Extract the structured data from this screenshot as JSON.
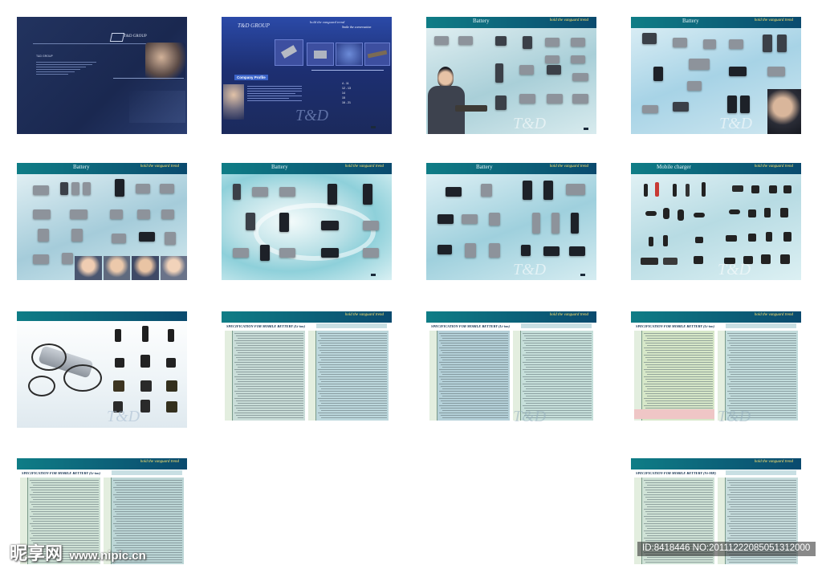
{
  "brand": {
    "name": "T&D GROUP",
    "slogan": "hold the vanguard trend",
    "slogan2": "Smile the conversation"
  },
  "pages": {
    "cover": {
      "group": "T&D GROUP"
    },
    "profile": {
      "group": "T&D GROUP",
      "section": "Company Profile",
      "toc": [
        "4 - 11",
        "12 - 13",
        "14",
        "15",
        "16 - 21"
      ]
    },
    "battery1": {
      "title": "Battery"
    },
    "battery2": {
      "title": "Battery"
    },
    "battery3": {
      "title": "Battery"
    },
    "battery4": {
      "title": "Battery"
    },
    "battery5": {
      "title": "Battery"
    },
    "charger": {
      "title": "Mobile charger"
    },
    "spec1": {
      "title": "SPECIFICATION FOR MOBILE BETTERY (Li-ion)"
    },
    "spec2": {
      "title": "SPECIFICATION FOR MOBILE BETTERY (Li-ion)"
    },
    "spec3": {
      "title": "SPECIFICATION FOR MOBILE BETTERY (Li-ion)"
    },
    "spec4": {
      "title": "SPECIFICATION FOR MOBILE BETTERY (Li-ion)"
    },
    "spec5": {
      "title": "SPECIFICATION FOR MOBILE BETTERY (Ni-MH)"
    }
  },
  "site_watermark": {
    "logo": "昵享网",
    "url": "www.nipic.cn"
  },
  "image_id": "ID:8418446 NO:20111222085051312000",
  "colors": {
    "navy": "#1f2f5c",
    "teal": "#0f7d86",
    "table": "#c9ddd8"
  }
}
